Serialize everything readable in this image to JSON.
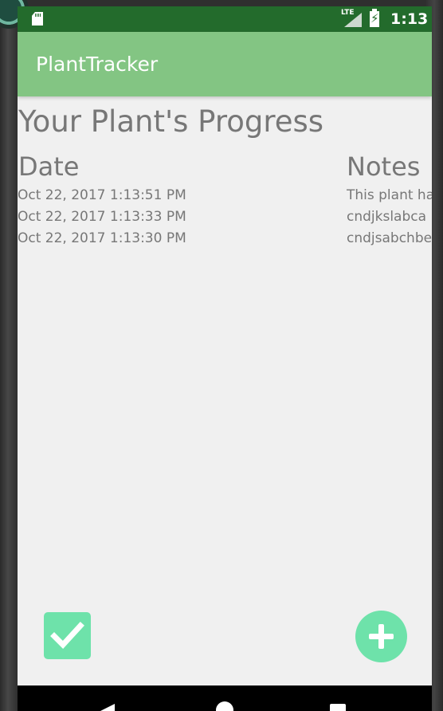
{
  "status_bar": {
    "network": "LTE",
    "time": "1:13",
    "battery_charge_symbol": "⚡",
    "icons": [
      "sd-card-icon",
      "signal-icon",
      "battery-charging-icon"
    ]
  },
  "app_bar": {
    "title": "PlantTracker",
    "background_color": "#83c583"
  },
  "main": {
    "title": "Your Plant's Progress",
    "columns": {
      "date": "Date",
      "notes": "Notes"
    },
    "entries": [
      {
        "date": "Oct 22, 2017 1:13:51 PM",
        "note": "This plant ha"
      },
      {
        "date": "Oct 22, 2017 1:13:33 PM",
        "note": "cndjkslabca"
      },
      {
        "date": "Oct 22, 2017 1:13:30 PM",
        "note": "cndjsabchbe"
      }
    ]
  },
  "actions": {
    "done_icon": "check-icon",
    "add_icon": "plus-icon",
    "accent_color": "#6ee2aa"
  },
  "navigation": {
    "items": [
      "back-icon",
      "home-icon",
      "recent-apps-icon"
    ]
  },
  "colors": {
    "status_bar": "#236b2c",
    "screen_background": "#f0f0f0",
    "text_gray": "#777777"
  }
}
